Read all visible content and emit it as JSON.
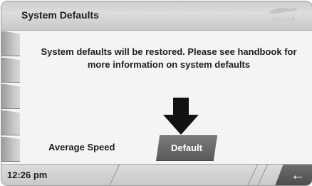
{
  "header": {
    "title": "System Defaults",
    "brand": "JAGUAR"
  },
  "main": {
    "message": "System defaults will be restored. Please see handbook for more information on system defaults",
    "setting_label": "Average Speed",
    "default_button": "Default"
  },
  "footer": {
    "time": "12:26 pm",
    "back_icon": "←"
  },
  "colors": {
    "header_bg": "#d3d3d3",
    "button_bg": "#666666",
    "text": "#1e1e1e"
  }
}
